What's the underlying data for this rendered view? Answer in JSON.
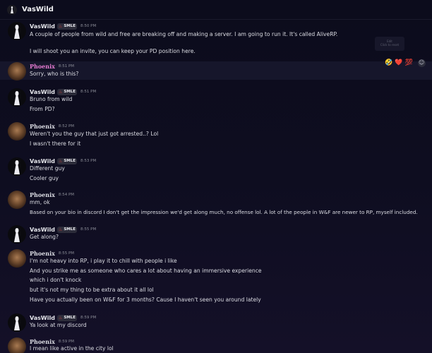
{
  "header": {
    "title": "VasWild"
  },
  "tooltip": {
    "line1": "Edit",
    "line2": "Click to reset"
  },
  "reactions": {
    "r1": "🤣",
    "r2": "❤️",
    "r3": "💯",
    "add": "☺"
  },
  "users": {
    "vas": "VasWild",
    "pho": "Phoenix",
    "tag": "SMLE"
  },
  "messages": {
    "m1": {
      "time": "8:50 PM",
      "l1": "A couple of people from wild and free are breaking off and making a server. I am going to run it. It's called AliveRP.",
      "l2": "I will shoot you an invite, you can keep your PD position here."
    },
    "m2": {
      "time": "8:51 PM",
      "l1": "Sorry, who is this?"
    },
    "m3": {
      "time": "8:51 PM",
      "l1": "Bruno from wild",
      "l2": "From PD?"
    },
    "m4": {
      "time": "8:52 PM",
      "l1": "Weren't you the guy that just got arrested..? Lol",
      "l2": "I wasn't there for it"
    },
    "m5": {
      "time": "8:53 PM",
      "l1": "Different guy",
      "l2": "Cooler guy"
    },
    "m6": {
      "time": "8:54 PM",
      "l1": "mm, ok",
      "l2": "Based on your bio in discord I don't get the impression we'd get along much, no offense lol. A lot of the people in W&F are newer to RP, myself included."
    },
    "m7": {
      "time": "8:55 PM",
      "l1": "Get along?"
    },
    "m8": {
      "time": "8:55 PM",
      "l1": "I'm not heavy into RP, i play it to chill with people i like",
      "l2": "And you strike me as someone who cares a lot about having an immersive experience",
      "l3": "which i don't knock",
      "l4": "but it's not my thing to be extra about it all lol",
      "l5": "Have you actually been on W&F for 3 months? Cause I haven't seen you around lately"
    },
    "m9": {
      "time": "8:59 PM",
      "l1": "Ya look at my discord"
    },
    "m10": {
      "time": "8:59 PM",
      "l1": "I mean like active in the city lol"
    }
  }
}
